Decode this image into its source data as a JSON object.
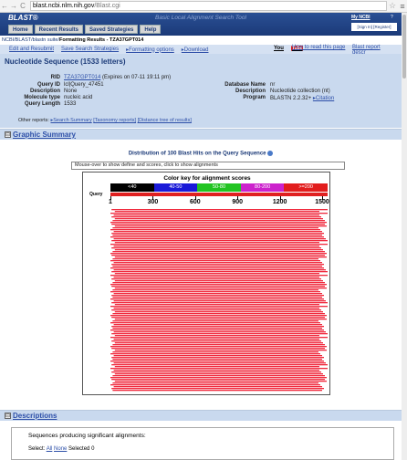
{
  "browser": {
    "url_domain": "blast.ncbi.nlm.nih.gov",
    "url_path": "/Blast.cgi"
  },
  "header": {
    "logo": "BLAST®",
    "tagline": "Basic Local Alignment Search Tool",
    "my_ncbi": "My NCBI",
    "help_mark": "?",
    "signin": "[Sign In] [Register]",
    "tabs": [
      "Home",
      "Recent Results",
      "Saved Strategies",
      "Help"
    ]
  },
  "breadcrumb": {
    "ncbi": "NCBI/",
    "blast": "BLAST/",
    "suite": "blastn suite/",
    "current": "Formatting Results - TZA37GPT014"
  },
  "toolbar": {
    "edit": "Edit and Resubmit",
    "save": "Save Search Strategies",
    "format": "▸Formatting options",
    "download": "▸Download",
    "yt_you": "You",
    "yt_tube": "Tube",
    "howto": "How to read this page",
    "report": "Blast report descr"
  },
  "summary": {
    "title": "Nucleotide Sequence (1533 letters)",
    "rid_label": "RID",
    "rid": "TZA37GPT014",
    "rid_expires": "(Expires on 07-11 19:11 pm)",
    "queryid_label": "Query ID",
    "queryid": "lcl|Query_47451",
    "desc_label": "Description",
    "desc": "None",
    "moltype_label": "Molecule type",
    "moltype": "nucleic acid",
    "qlen_label": "Query Length",
    "qlen": "1533",
    "db_label": "Database Name",
    "db": "nr",
    "dbdesc_label": "Description",
    "dbdesc": "Nucleotide collection (nt)",
    "program_label": "Program",
    "program": "BLASTN 2.2.32+",
    "citation": "▸Citation",
    "other_reports_label": "Other reports:",
    "search_summary": "▸Search Summary",
    "taxonomy": "[Taxonomy reports]",
    "distance": "[Distance tree of results]"
  },
  "graphic": {
    "section_title": "Graphic Summary",
    "toggle": "⊟",
    "dist_title": "Distribution of 100 Blast Hits on the Query Sequence",
    "hint": "Mouse-over to show define and scores, click to show alignments",
    "key_title": "Color key for alignment scores",
    "key": [
      {
        "label": "<40",
        "color": "#000000"
      },
      {
        "label": "40-50",
        "color": "#1a1ad8"
      },
      {
        "label": "50-80",
        "color": "#22c422"
      },
      {
        "label": "80-200",
        "color": "#cc22cc"
      },
      {
        "label": ">=200",
        "color": "#e21d1d"
      }
    ],
    "query_label": "Query",
    "hit_color": "#f0283c",
    "ticks": [
      "1",
      "300",
      "600",
      "900",
      "1200",
      "1500"
    ]
  },
  "descriptions": {
    "section_title": "Descriptions",
    "toggle": "⊟",
    "producing": "Sequences producing significant alignments:",
    "select_label": "Select:",
    "select_all": "All",
    "select_none": "None",
    "selected": "Selected 0"
  }
}
